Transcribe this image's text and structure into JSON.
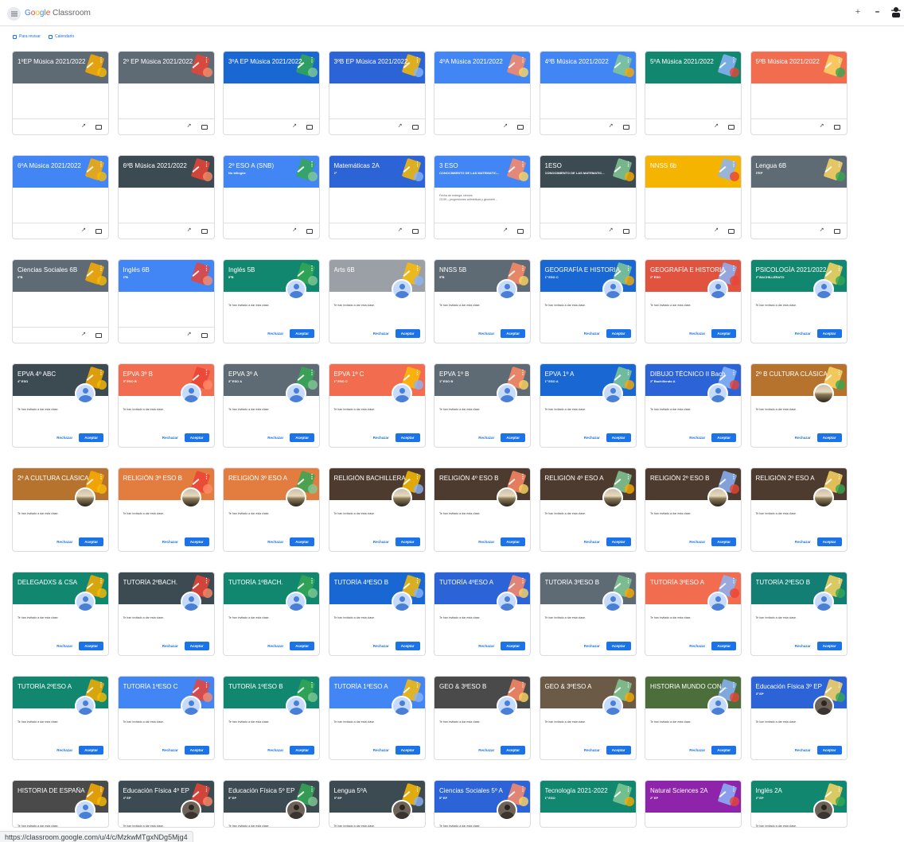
{
  "app": {
    "brand_google": "Google",
    "brand_product": "Classroom"
  },
  "toolbar": {
    "plus_icon": "+",
    "apps_icon": "⋮⋮⋮"
  },
  "subbar": {
    "to_review": "Para revisar",
    "calendar": "Calendario"
  },
  "labels": {
    "invite": "Te han invitado a dar esta clase.",
    "reject": "Rechazar",
    "accept": "Aceptar",
    "menu_dots": "⋮"
  },
  "colors": {
    "gray": "#5f6b74",
    "red": "#e0533f",
    "blue": "#1e6cd6",
    "royal": "#2c63d6",
    "lblue": "#4285f4",
    "green": "#12876f",
    "coral": "#f26d4f",
    "dark": "#3c4a52",
    "yellow": "#f4b400",
    "teal": "#127e74",
    "lightgray": "#9aa0a6",
    "deepblue": "#1967d2",
    "orange": "#e37c3f",
    "ochre": "#b5732e",
    "brown": "#4e3b30",
    "purple": "#8e24aa",
    "darkgray": "#4a4a4a",
    "sepia": "#6b5a45",
    "olive": "#4b6e3a"
  },
  "cards": [
    {
      "title": "1ºEP Música 2021/2022",
      "sub": "",
      "color": "gray",
      "type": "own"
    },
    {
      "title": "2º EP Música 2021/2022",
      "sub": "",
      "color": "gray",
      "type": "own"
    },
    {
      "title": "3ºA EP Música 2021/2022",
      "sub": "",
      "color": "deepblue",
      "type": "own"
    },
    {
      "title": "3ºB EP Música 2021/2022",
      "sub": "",
      "color": "royal",
      "type": "own"
    },
    {
      "title": "4ºA Música 2021/2022",
      "sub": "",
      "color": "lblue",
      "type": "own"
    },
    {
      "title": "4ºB Música 2021/2022",
      "sub": "",
      "color": "lblue",
      "type": "own"
    },
    {
      "title": "5ºA Música 2021/2022",
      "sub": "",
      "color": "green",
      "type": "own"
    },
    {
      "title": "5ºB Música 2021/2022",
      "sub": "",
      "color": "coral",
      "type": "own"
    },
    {
      "title": "6ºA Música 2021/2022",
      "sub": "",
      "color": "lblue",
      "type": "own"
    },
    {
      "title": "6ºB Música 2021/2022",
      "sub": "",
      "color": "dark",
      "type": "own"
    },
    {
      "title": "2º ESO A (SNB)",
      "sub": "No bilingüe",
      "color": "lblue",
      "type": "own"
    },
    {
      "title": "Matemáticas 2A",
      "sub": "2º",
      "color": "royal",
      "type": "own"
    },
    {
      "title": "3 ESO",
      "sub": "CONOCIMIENTO DE LAS MATEMATIC...",
      "color": "lblue",
      "type": "own",
      "due1": "Fecha de entrega: viernes",
      "due2": "23:59 – progresiones aritméticas y geométri..."
    },
    {
      "title": "1ESO",
      "sub": "CONOCIMIENTO DE LAS MATEMATIC...",
      "color": "dark",
      "type": "own"
    },
    {
      "title": "NNSS 6b",
      "sub": "",
      "color": "yellow",
      "type": "own"
    },
    {
      "title": "Lengua 6B",
      "sub": "6ºEP",
      "color": "gray",
      "type": "own"
    },
    {
      "title": "Ciencias Sociales 6B",
      "sub": "6ºB",
      "color": "gray",
      "type": "own"
    },
    {
      "title": "Inglés 6B",
      "sub": "6ºB",
      "color": "lblue",
      "type": "own"
    },
    {
      "title": "Inglés 5B",
      "sub": "5ºB",
      "color": "green",
      "type": "invite",
      "avatar": "default"
    },
    {
      "title": "Arts 6B",
      "sub": "",
      "color": "lightgray",
      "type": "invite",
      "avatar": "default"
    },
    {
      "title": "NNSS 5B",
      "sub": "5ºB",
      "color": "gray",
      "type": "invite",
      "avatar": "default"
    },
    {
      "title": "GEOGRAFÍA E HISTORIA",
      "sub": "1º ESO C",
      "color": "deepblue",
      "type": "invite",
      "avatar": "default"
    },
    {
      "title": "GEOGRAFÍA E HISTORIA",
      "sub": "2º ESO",
      "color": "red",
      "type": "invite",
      "avatar": "default"
    },
    {
      "title": "PSICOLOGÍA 2021/2022",
      "sub": "2º BACHILLERATO",
      "color": "green",
      "type": "invite",
      "avatar": "default"
    },
    {
      "title": "EPVA 4º ABC",
      "sub": "4º ESO",
      "color": "dark",
      "type": "invite",
      "avatar": "default"
    },
    {
      "title": "EPVA 3º B",
      "sub": "3º ESO B",
      "color": "coral",
      "type": "invite",
      "avatar": "default"
    },
    {
      "title": "EPVA 3º A",
      "sub": "3º ESO A",
      "color": "gray",
      "type": "invite",
      "avatar": "default"
    },
    {
      "title": "EPVA 1º C",
      "sub": "1º ESO C",
      "color": "coral",
      "type": "invite",
      "avatar": "default"
    },
    {
      "title": "EPVA 1º B",
      "sub": "1º ESO B",
      "color": "gray",
      "type": "invite",
      "avatar": "default"
    },
    {
      "title": "EPVA 1º A",
      "sub": "1º ESO A",
      "color": "deepblue",
      "type": "invite",
      "avatar": "default"
    },
    {
      "title": "DIBUJO TÉCNICO II Bach",
      "sub": "2º Bachillerato A",
      "color": "royal",
      "type": "invite",
      "avatar": "default"
    },
    {
      "title": "2º B CULTURA CLÁSICA",
      "sub": "",
      "color": "ochre",
      "type": "invite",
      "avatar": "landscape"
    },
    {
      "title": "2º A CULTURA CLÁSICA",
      "sub": "",
      "color": "ochre",
      "type": "invite",
      "avatar": "landscape"
    },
    {
      "title": "RELIGIÓN 3º ESO B",
      "sub": "",
      "color": "orange",
      "type": "invite",
      "avatar": "landscape"
    },
    {
      "title": "RELIGIÓN 3º ESO A",
      "sub": "",
      "color": "orange",
      "type": "invite",
      "avatar": "landscape"
    },
    {
      "title": "RELIGIÓN BACHILLERATO",
      "sub": "",
      "color": "brown",
      "type": "invite",
      "avatar": "landscape"
    },
    {
      "title": "RELIGIÓN 4º ESO B",
      "sub": "",
      "color": "brown",
      "type": "invite",
      "avatar": "landscape"
    },
    {
      "title": "RELIGIÓN 4º ESO A",
      "sub": "",
      "color": "brown",
      "type": "invite",
      "avatar": "landscape"
    },
    {
      "title": "RELIGIÓN 2º ESO B",
      "sub": "",
      "color": "brown",
      "type": "invite",
      "avatar": "landscape"
    },
    {
      "title": "RELIGIÓN 2º ESO A",
      "sub": "",
      "color": "brown",
      "type": "invite",
      "avatar": "landscape"
    },
    {
      "title": "DELEGADXS & CSA",
      "sub": "",
      "color": "green",
      "type": "invite",
      "avatar": "default"
    },
    {
      "title": "TUTORÍA 2ºBACH.",
      "sub": "",
      "color": "dark",
      "type": "invite",
      "avatar": "default"
    },
    {
      "title": "TUTORÍA 1ºBACH.",
      "sub": "",
      "color": "green",
      "type": "invite",
      "avatar": "default"
    },
    {
      "title": "TUTORÍA 4ºESO B",
      "sub": "",
      "color": "deepblue",
      "type": "invite",
      "avatar": "default"
    },
    {
      "title": "TUTORÍA 4ºESO A",
      "sub": "",
      "color": "royal",
      "type": "invite",
      "avatar": "default"
    },
    {
      "title": "TUTORÍA 3ºESO B",
      "sub": "",
      "color": "gray",
      "type": "invite",
      "avatar": "default"
    },
    {
      "title": "TUTORÍA 3ºESO A",
      "sub": "",
      "color": "coral",
      "type": "invite",
      "avatar": "default"
    },
    {
      "title": "TUTORÍA 2ºESO B",
      "sub": "",
      "color": "teal",
      "type": "invite",
      "avatar": "default"
    },
    {
      "title": "TUTORÍA 2ºESO A",
      "sub": "",
      "color": "green",
      "type": "invite",
      "avatar": "default"
    },
    {
      "title": "TUTORÍA 1ºESO C",
      "sub": "",
      "color": "lblue",
      "type": "invite",
      "avatar": "default"
    },
    {
      "title": "TUTORÍA 1ºESO B",
      "sub": "",
      "color": "green",
      "type": "invite",
      "avatar": "default"
    },
    {
      "title": "TUTORÍA 1ºESO A",
      "sub": "",
      "color": "lblue",
      "type": "invite",
      "avatar": "default"
    },
    {
      "title": "GEO & 3ºESO B",
      "sub": "",
      "color": "darkgray",
      "type": "invite",
      "avatar": "default"
    },
    {
      "title": "GEO & 3ºESO A",
      "sub": "",
      "color": "sepia",
      "type": "invite",
      "avatar": "default"
    },
    {
      "title": "HISTORIA MUNDO CONTEMPORÁNEO",
      "sub": "",
      "color": "olive",
      "type": "invite",
      "avatar": "default"
    },
    {
      "title": "Educación Física 3º EP",
      "sub": "3º EP",
      "color": "royal",
      "type": "invite",
      "avatar": "photo"
    },
    {
      "title": "HISTORIA DE ESPAÑA",
      "sub": "",
      "color": "darkgray",
      "type": "invite",
      "avatar": "default"
    },
    {
      "title": "Educación Física 4º EP",
      "sub": "4º EP",
      "color": "dark",
      "type": "invite",
      "avatar": "photo"
    },
    {
      "title": "Educación Física 5º EP",
      "sub": "5º EP",
      "color": "dark",
      "type": "invite",
      "avatar": "photo"
    },
    {
      "title": "Lengua 5ºA",
      "sub": "5º EP",
      "color": "dark",
      "type": "invite",
      "avatar": "photo"
    },
    {
      "title": "Ciencias Sociales 5º A",
      "sub": "5º EP",
      "color": "royal",
      "type": "invite",
      "avatar": "photo"
    },
    {
      "title": "Tecnología 2021-2022",
      "sub": "1º ESO",
      "color": "green",
      "type": "own"
    },
    {
      "title": "Natural Sciences 2A",
      "sub": "2º EP",
      "color": "purple",
      "type": "own"
    },
    {
      "title": "Inglés 2A",
      "sub": "2º EP",
      "color": "green",
      "type": "invite",
      "avatar": "photo"
    }
  ],
  "status_url": "https://classroom.google.com/u/4/c/MzkwMTgxNDg5Mjg4"
}
